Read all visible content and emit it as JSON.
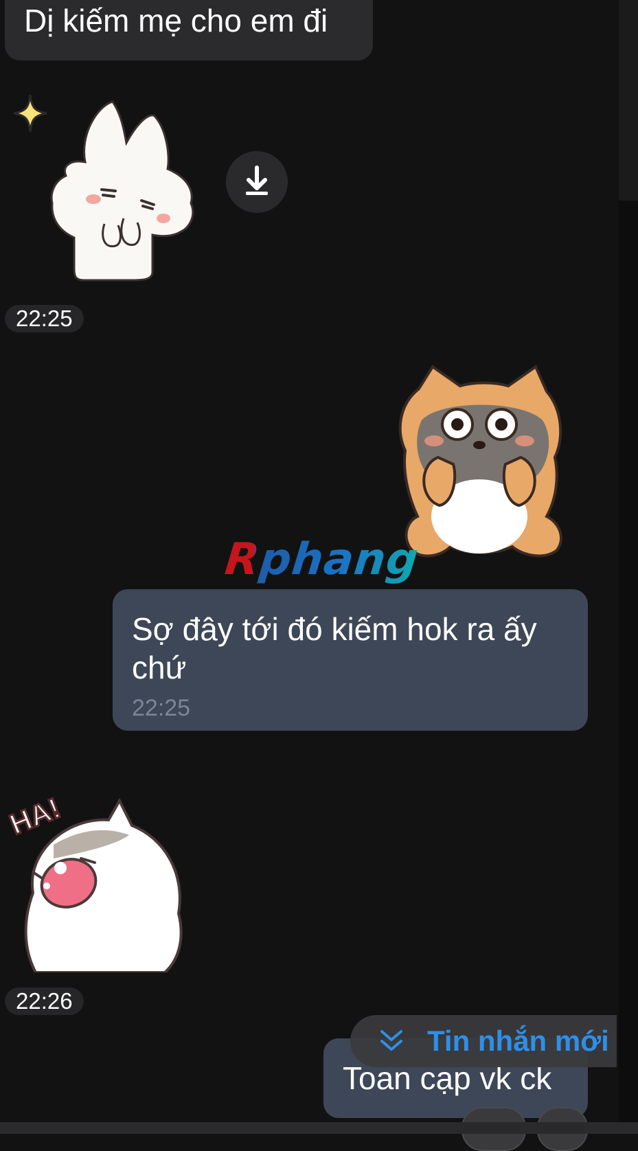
{
  "messages": {
    "incoming_text": "Dị kiếm mẹ cho em đi",
    "incoming_sticker_time": "22:25",
    "outgoing_text": "Sợ đây tới đó kiếm hok ra ấy chứ",
    "outgoing_time": "22:25",
    "incoming_sticker2_text": "HA!",
    "incoming_sticker2_time": "22:26",
    "outgoing_text2": "Toan cạp vk ck"
  },
  "watermark": "Rphang",
  "new_messages_button": {
    "label": "Tin nhắn mới"
  },
  "icons": {
    "download": "download-icon",
    "chevrons": "double-chevron-down-icon",
    "sparkle": "sparkle-icon"
  },
  "colors": {
    "background": "#121213",
    "incoming_bubble": "#2b2b2d",
    "outgoing_bubble": "#3d4757",
    "accent": "#2e8fe8"
  }
}
